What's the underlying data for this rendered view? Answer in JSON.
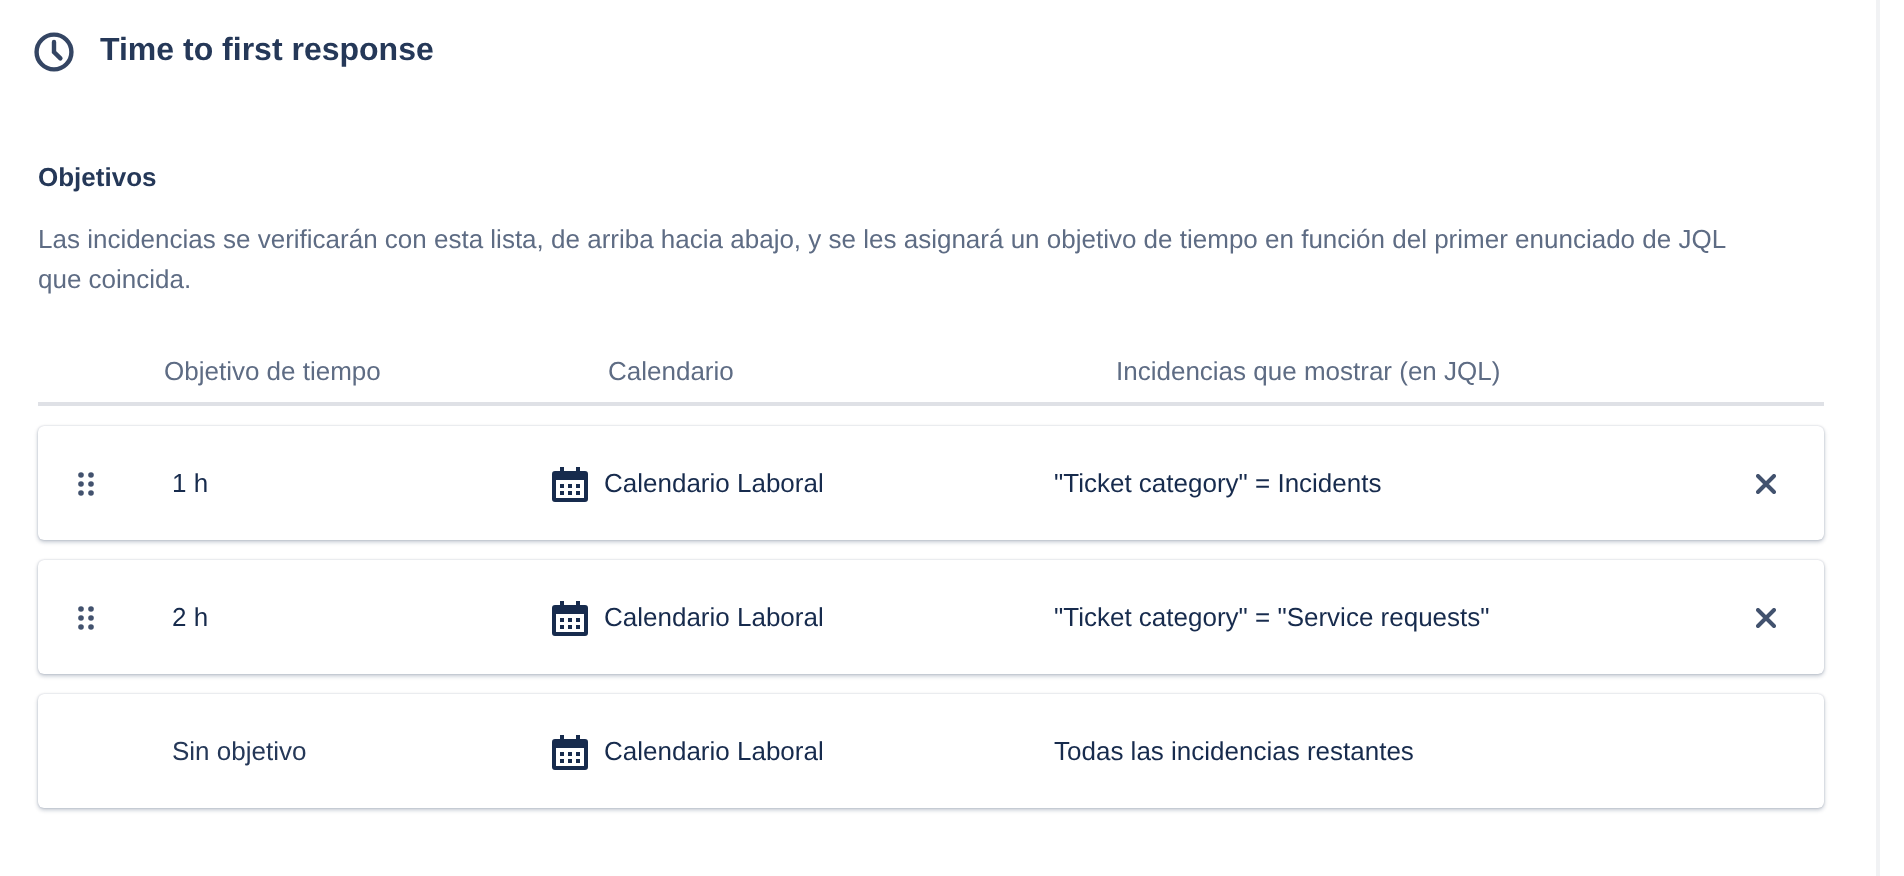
{
  "header": {
    "title": "Time to first response"
  },
  "section": {
    "title": "Objetivos",
    "description": "Las incidencias se verificarán con esta lista, de arriba hacia abajo, y se les asignará un objetivo de tiempo en función del primer enunciado de JQL que coincida."
  },
  "table": {
    "columns": [
      "Objetivo de tiempo",
      "Calendario",
      "Incidencias que mostrar (en JQL)"
    ],
    "rows": [
      {
        "kind": "goal",
        "time": "1 h",
        "calendar": "Calendario Laboral",
        "jql": "\"Ticket category\" = Incidents"
      },
      {
        "kind": "goal",
        "time": "2 h",
        "calendar": "Calendario Laboral",
        "jql": "\"Ticket category\" = \"Service requests\""
      },
      {
        "kind": "default",
        "time": "Sin objetivo",
        "calendar": "Calendario Laboral",
        "jql": "Todas las incidencias restantes"
      }
    ]
  }
}
